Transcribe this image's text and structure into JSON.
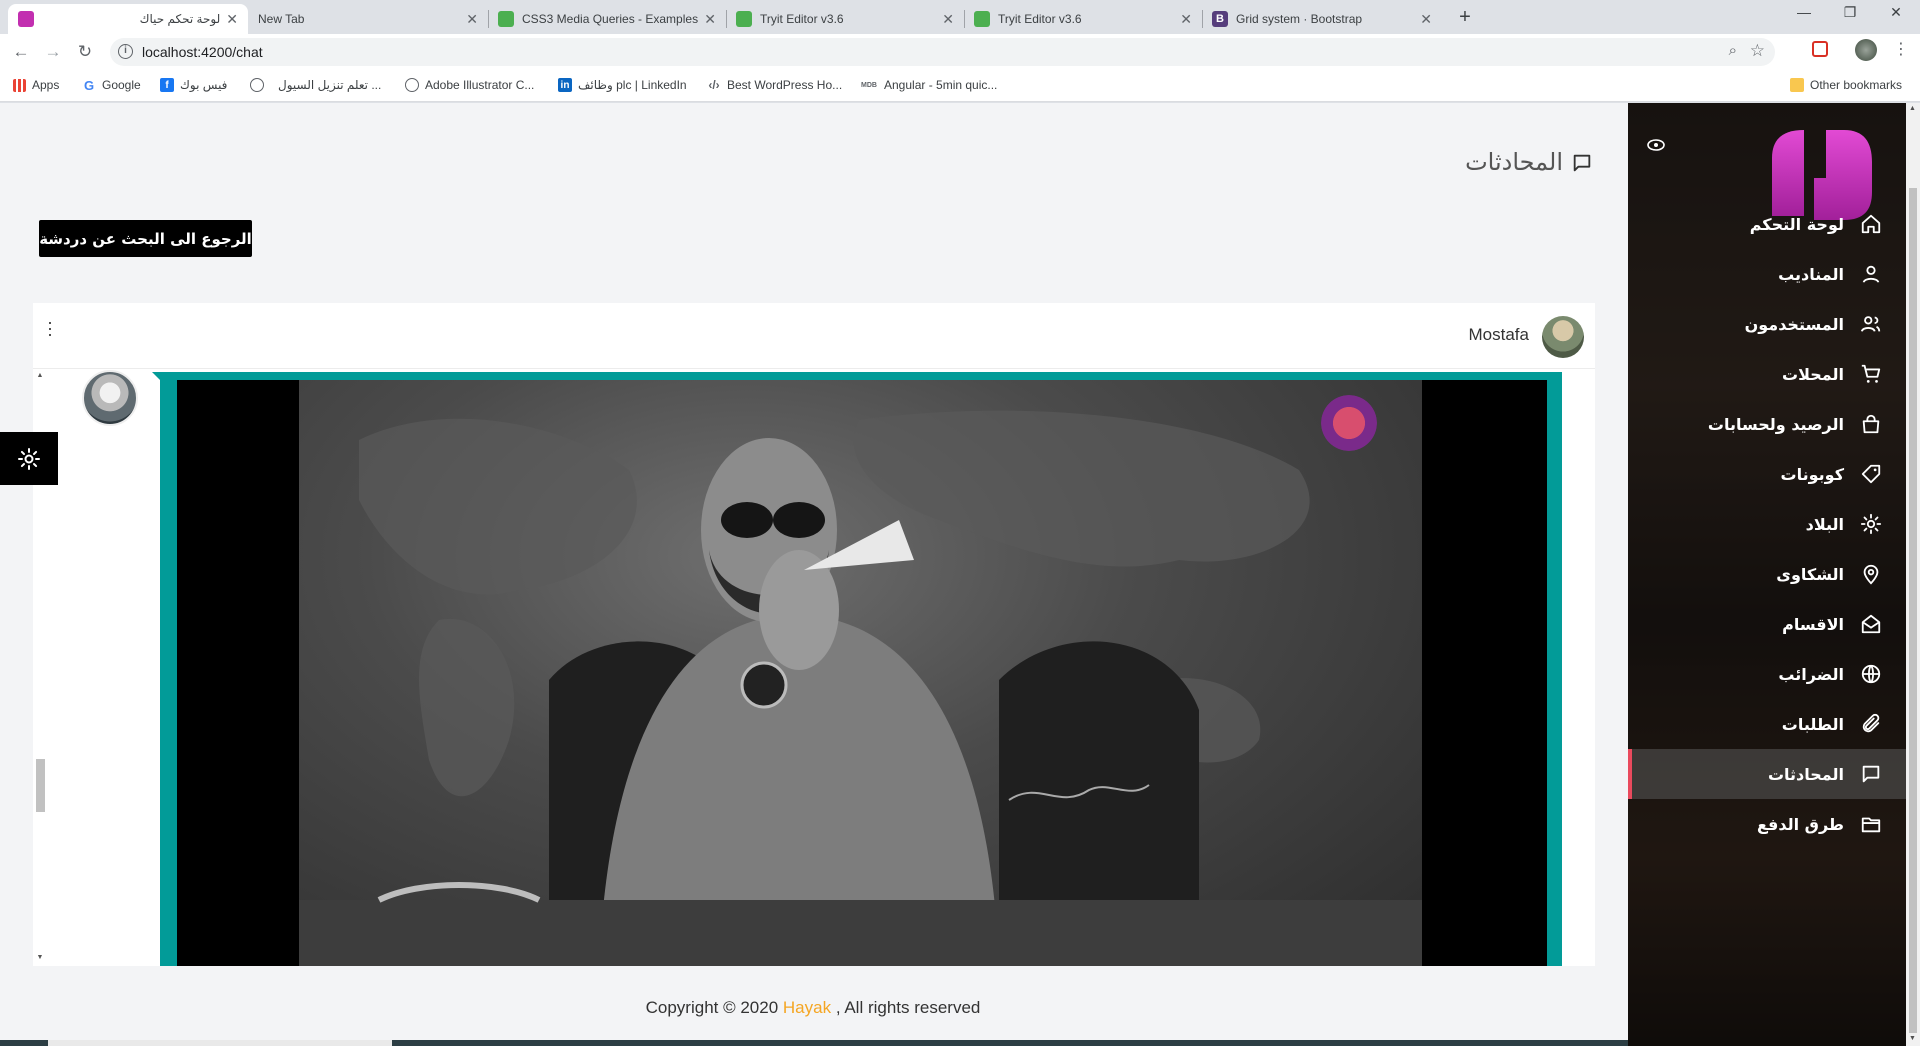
{
  "browser": {
    "tabs": [
      {
        "title": "لوحة تحكم حياك",
        "active": true,
        "icon": "hayak-icon"
      },
      {
        "title": "New Tab",
        "active": false,
        "icon": "none"
      },
      {
        "title": "CSS3 Media Queries - Examples",
        "active": false,
        "icon": "w3-icon"
      },
      {
        "title": "Tryit Editor v3.6",
        "active": false,
        "icon": "w3-icon"
      },
      {
        "title": "Tryit Editor v3.6",
        "active": false,
        "icon": "w3-icon"
      },
      {
        "title": "Grid system · Bootstrap",
        "active": false,
        "icon": "bootstrap-icon"
      }
    ],
    "url": "localhost:4200/chat",
    "bookmarks": [
      {
        "label": "Apps"
      },
      {
        "label": "Google"
      },
      {
        "label": "فيس بوك"
      },
      {
        "label": "تعلم تنزيل السيول ..."
      },
      {
        "label": "Adobe Illustrator C..."
      },
      {
        "label": "وظائف plc | LinkedIn"
      },
      {
        "label": "Best WordPress Ho..."
      },
      {
        "label": "Angular - 5min quic..."
      }
    ],
    "other_bookmarks": "Other bookmarks"
  },
  "page": {
    "title": "المحادثات",
    "back_button": "الرجوع الى البحث عن دردشة",
    "chat": {
      "user_name": "Mostafa"
    },
    "footer": {
      "prefix": "Copyright © 2020 ",
      "brand": "Hayak",
      "suffix": " , All rights reserved"
    }
  },
  "sidebar": {
    "items": [
      {
        "label": "لوحة التحكم",
        "icon": "home-icon"
      },
      {
        "label": "المناديب",
        "icon": "user-icon"
      },
      {
        "label": "المستخدمون",
        "icon": "users-icon"
      },
      {
        "label": "المحلات",
        "icon": "cart-icon"
      },
      {
        "label": "الرصيد ولحسابات",
        "icon": "bag-icon"
      },
      {
        "label": "كوبونات",
        "icon": "ticket-icon"
      },
      {
        "label": "البلاد",
        "icon": "gear-icon"
      },
      {
        "label": "الشكاوى",
        "icon": "location-pin-icon"
      },
      {
        "label": "الاقسام",
        "icon": "envelope-open-icon"
      },
      {
        "label": "الضرائب",
        "icon": "globe-icon"
      },
      {
        "label": "الطلبات",
        "icon": "paperclip-icon"
      },
      {
        "label": "المحادثات",
        "icon": "chat-icon",
        "active": true
      },
      {
        "label": "طرق الدفع",
        "icon": "folder-icon"
      }
    ]
  },
  "colors": {
    "accent": "#029b98",
    "brand_orange": "#f5a623",
    "active_marker": "#e94a5d",
    "logo_magenta": "#c22fb0"
  }
}
